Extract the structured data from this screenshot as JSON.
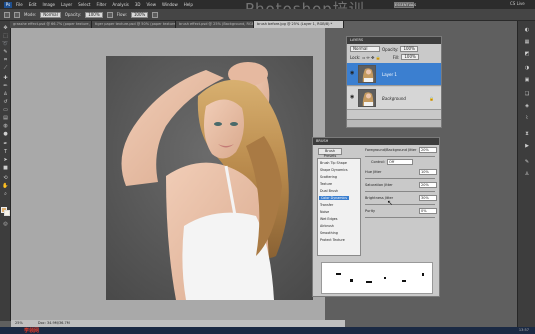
{
  "menu": {
    "items": [
      "File",
      "Edit",
      "Image",
      "Layer",
      "Select",
      "Filter",
      "Analysis",
      "3D",
      "View",
      "Window",
      "Help"
    ],
    "workspace": "ESSENTIALS",
    "cs_live": "CS Live"
  },
  "watermark": "Photoshop培训",
  "options": {
    "mode_label": "Mode:",
    "mode_value": "Normal",
    "opacity_label": "Opacity:",
    "opacity_value": "100%",
    "flow_label": "Flow:",
    "flow_value": "100%"
  },
  "tabs": [
    {
      "label": "grasshe effect.psd @ 66.7% (paper texture, RGB/8) *"
    },
    {
      "label": "tiger paper texture.psd @ 50% (paper texture, RGB/8)"
    },
    {
      "label": "brush effect.psd @ 25% (Background, RGB/8)"
    },
    {
      "label": "brush before.jpg @ 25% (Layer 1, RGB/8) *"
    }
  ],
  "status": {
    "zoom": "25%",
    "doc": "Doc: 34.9M/36.7M"
  },
  "taskbar": {
    "logo": "学领网",
    "time": "13:57"
  },
  "layers": {
    "title": "LAYERS",
    "blend_mode": "Normal",
    "opacity_label": "Opacity:",
    "opacity_value": "100%",
    "lock_label": "Lock:",
    "fill_label": "Fill:",
    "fill_value": "100%",
    "items": [
      {
        "name": "Layer 1",
        "selected": true
      },
      {
        "name": "Background",
        "selected": false,
        "locked": true
      }
    ]
  },
  "brush": {
    "title": "BRUSH",
    "presets_button": "Brush Presets",
    "options": [
      {
        "label": "Brush Tip Shape",
        "checked": false
      },
      {
        "label": "Shape Dynamics",
        "checked": true
      },
      {
        "label": "Scattering",
        "checked": true
      },
      {
        "label": "Texture",
        "checked": false
      },
      {
        "label": "Dual Brush",
        "checked": false
      },
      {
        "label": "Color Dynamics",
        "checked": true
      },
      {
        "label": "Transfer",
        "checked": false
      },
      {
        "label": "Noise",
        "checked": false
      },
      {
        "label": "Wet Edges",
        "checked": false
      },
      {
        "label": "Airbrush",
        "checked": false
      },
      {
        "label": "Smoothing",
        "checked": true
      },
      {
        "label": "Protect Texture",
        "checked": false
      }
    ],
    "params": {
      "fgbg_label": "Foreground/Background Jitter",
      "fgbg_value": "20%",
      "control_label": "Control:",
      "control_value": "Off",
      "hue_label": "Hue Jitter",
      "hue_value": "10%",
      "sat_label": "Saturation Jitter",
      "sat_value": "20%",
      "bright_label": "Brightness Jitter",
      "bright_value": "30%",
      "purity_label": "Purity",
      "purity_value": "0%"
    }
  },
  "colors": {
    "foreground": "#e0b070",
    "background": "#f7f3e9",
    "selection": "#3b7fd0"
  }
}
